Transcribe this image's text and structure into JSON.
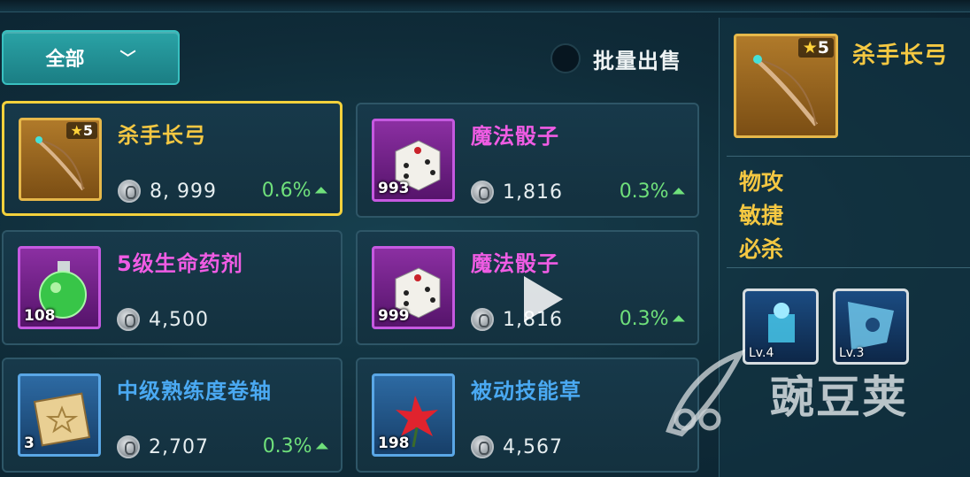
{
  "filter": {
    "label": "全部",
    "chevron_icon": "chevron-down-icon"
  },
  "bulk_sell": {
    "label": "批量出售",
    "checked": false
  },
  "items": [
    {
      "name": "杀手长弓",
      "stars": "5",
      "qty": "",
      "price": "8, 999",
      "change": "0.6%",
      "rarity": "gold",
      "icon": "longbow-icon",
      "selected": true
    },
    {
      "name": "魔法骰子",
      "stars": "",
      "qty": "993",
      "price": "1,816",
      "change": "0.3%",
      "rarity": "purple",
      "icon": "dice-icon",
      "selected": false
    },
    {
      "name": "5级生命药剂",
      "stars": "",
      "qty": "108",
      "price": "4,500",
      "change": "",
      "rarity": "purple",
      "icon": "potion-icon",
      "selected": false
    },
    {
      "name": "魔法骰子",
      "stars": "",
      "qty": "999",
      "price": "1,816",
      "change": "0.3%",
      "rarity": "purple",
      "icon": "dice-icon",
      "selected": false
    },
    {
      "name": "中级熟练度卷轴",
      "stars": "",
      "qty": "3",
      "price": "2,707",
      "change": "0.3%",
      "rarity": "blue",
      "icon": "scroll-icon",
      "selected": false
    },
    {
      "name": "被动技能草",
      "stars": "",
      "qty": "198",
      "price": "4,567",
      "change": "",
      "rarity": "blue",
      "icon": "herb-icon",
      "selected": false
    }
  ],
  "detail": {
    "name": "杀手长弓",
    "stars": "5",
    "stats": [
      "物攻",
      "敏捷",
      "必杀"
    ],
    "skills": [
      {
        "level": "Lv.4",
        "icon": "frost-tower-skill-icon"
      },
      {
        "level": "Lv.3",
        "icon": "banner-skill-icon"
      }
    ]
  },
  "overlay": {
    "watermark": "豌豆荚",
    "play_icon": "play-icon"
  },
  "colors": {
    "gold": "#f5c842",
    "pink": "#f05ce4",
    "blue": "#4aa9f2",
    "up": "#6fe07b",
    "select": "#f3d13c",
    "teal": "#1b7e84"
  }
}
